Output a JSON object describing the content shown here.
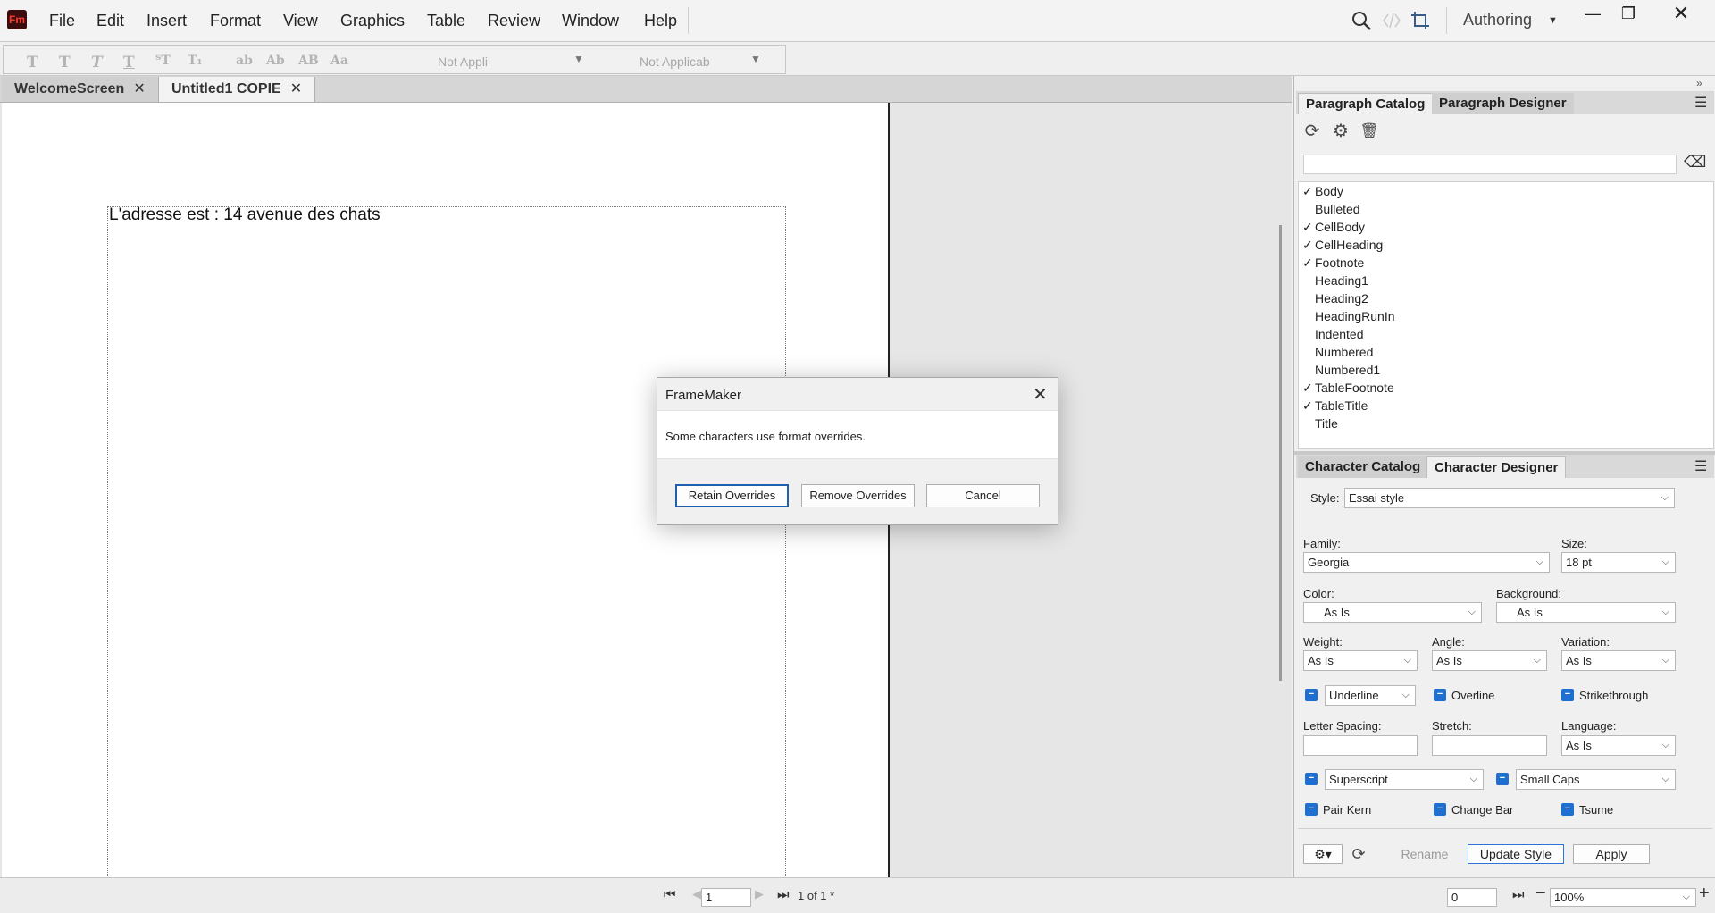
{
  "app": {
    "logo": "Fm",
    "mode": "Authoring"
  },
  "menu": [
    "File",
    "Edit",
    "Insert",
    "Format",
    "View",
    "Graphics",
    "Table",
    "Review",
    "Window",
    "Help"
  ],
  "toolbar": {
    "para_dropdown": "Not Appli",
    "char_dropdown": "Not Applicab"
  },
  "tabs": [
    {
      "label": "WelcomeScreen",
      "close": "✕"
    },
    {
      "label": "Untitled1 COPIE",
      "close": "✕"
    }
  ],
  "document": {
    "text": "L'adresse est : 14 avenue des chats"
  },
  "paragraph_panel": {
    "tabs": [
      "Paragraph Catalog",
      "Paragraph Designer"
    ],
    "items": [
      {
        "name": "Body",
        "check": "✓"
      },
      {
        "name": "Bulleted",
        "check": ""
      },
      {
        "name": "CellBody",
        "check": "✓"
      },
      {
        "name": "CellHeading",
        "check": "✓"
      },
      {
        "name": "Footnote",
        "check": "✓"
      },
      {
        "name": "Heading1",
        "check": ""
      },
      {
        "name": "Heading2",
        "check": ""
      },
      {
        "name": "HeadingRunIn",
        "check": ""
      },
      {
        "name": "Indented",
        "check": ""
      },
      {
        "name": "Numbered",
        "check": ""
      },
      {
        "name": "Numbered1",
        "check": ""
      },
      {
        "name": "TableFootnote",
        "check": "✓"
      },
      {
        "name": "TableTitle",
        "check": "✓"
      },
      {
        "name": "Title",
        "check": ""
      }
    ]
  },
  "character_panel": {
    "tabs": [
      "Character Catalog",
      "Character Designer"
    ],
    "style_label": "Style:",
    "style_value": "Essai style",
    "family_label": "Family:",
    "family_value": "Georgia",
    "size_label": "Size:",
    "size_value": "18 pt",
    "color_label": "Color:",
    "color_value": "As Is",
    "background_label": "Background:",
    "background_value": "As Is",
    "weight_label": "Weight:",
    "weight_value": "As Is",
    "angle_label": "Angle:",
    "angle_value": "As Is",
    "variation_label": "Variation:",
    "variation_value": "As Is",
    "underline_value": "Underline",
    "overline_label": "Overline",
    "strikethrough_label": "Strikethrough",
    "letter_spacing_label": "Letter Spacing:",
    "stretch_label": "Stretch:",
    "language_label": "Language:",
    "language_value": "As Is",
    "superscript_value": "Superscript",
    "smallcaps_value": "Small Caps",
    "pairkern_label": "Pair Kern",
    "changebar_label": "Change Bar",
    "tsume_label": "Tsume",
    "rename_label": "Rename",
    "update_label": "Update Style",
    "apply_label": "Apply"
  },
  "statusbar": {
    "page_input": "1",
    "page_info": "1 of 1 *",
    "nav_value": "0",
    "zoom": "100%"
  },
  "dialog": {
    "title": "FrameMaker",
    "message": "Some characters use format overrides.",
    "retain_label": "Retain Overrides",
    "remove_label": "Remove Overrides",
    "cancel_label": "Cancel"
  }
}
